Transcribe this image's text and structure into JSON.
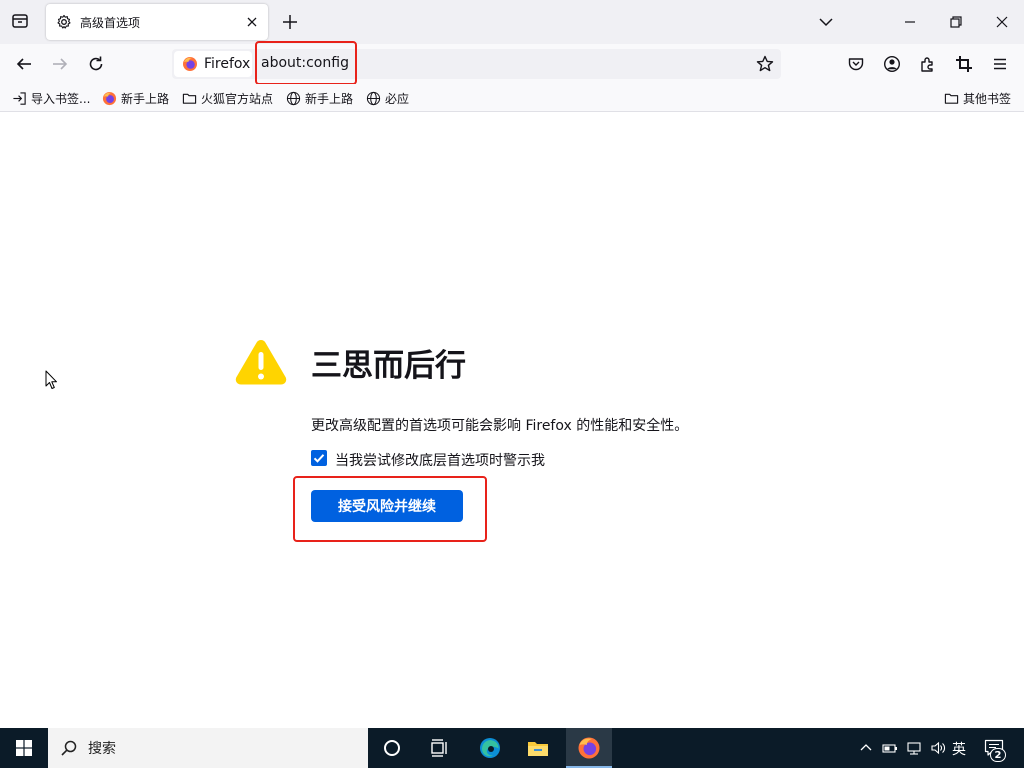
{
  "tab": {
    "title": "高级首选项"
  },
  "nav": {
    "identity_label": "Firefox",
    "url": "about:config"
  },
  "bookmarks": {
    "items": [
      {
        "label": "导入书签...",
        "icon": "import-icon"
      },
      {
        "label": "新手上路",
        "icon": "firefox-icon"
      },
      {
        "label": "火狐官方站点",
        "icon": "folder-icon"
      },
      {
        "label": "新手上路",
        "icon": "globe-icon"
      },
      {
        "label": "必应",
        "icon": "globe-icon"
      }
    ],
    "other": "其他书签"
  },
  "warning": {
    "title": "三思而后行",
    "description": "更改高级配置的首选项可能会影响 Firefox 的性能和安全性。",
    "checkbox_label": "当我尝试修改底层首选项时警示我",
    "checkbox_checked": true,
    "accept_button": "接受风险并继续"
  },
  "taskbar": {
    "search_placeholder": "搜索",
    "ime": "英",
    "notification_count": "2"
  },
  "colors": {
    "accent": "#0061e0",
    "warning": "#ffd400",
    "highlight": "#e8221a",
    "taskbar": "#0b1b28"
  }
}
